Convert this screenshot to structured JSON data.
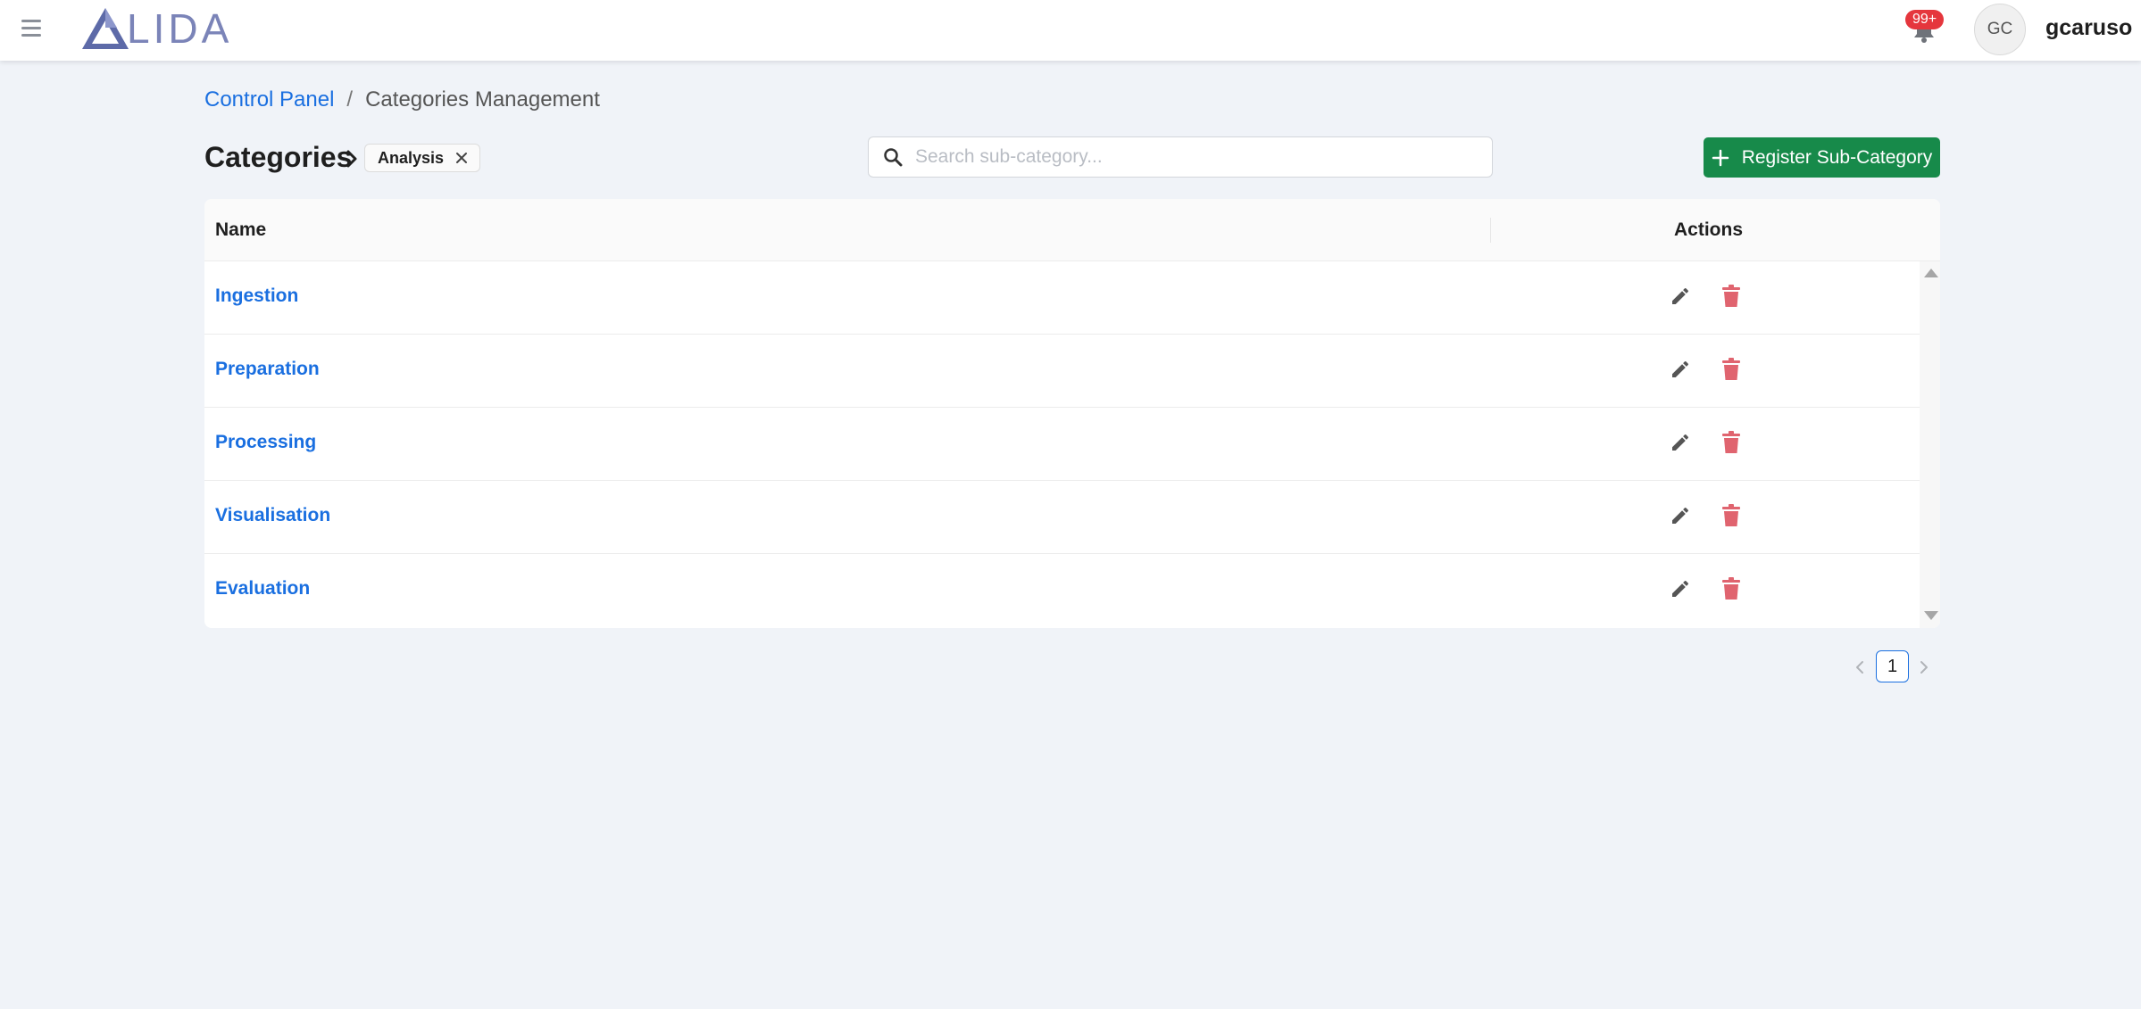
{
  "app": {
    "logo_text": "LIDA",
    "notifications_badge": "99+",
    "avatar_initials": "GC",
    "username": "gcaruso"
  },
  "breadcrumb": {
    "parent": "Control Panel",
    "separator": "/",
    "current": "Categories Management"
  },
  "header": {
    "title": "Categories",
    "filter_chip": "Analysis",
    "search_placeholder": "Search sub-category...",
    "register_label": "Register Sub-Category"
  },
  "table": {
    "columns": {
      "name": "Name",
      "actions": "Actions"
    },
    "rows": [
      {
        "name": "Ingestion"
      },
      {
        "name": "Preparation"
      },
      {
        "name": "Processing"
      },
      {
        "name": "Visualisation"
      },
      {
        "name": "Evaluation"
      }
    ]
  },
  "pagination": {
    "current_page": "1"
  },
  "icons": {
    "menu": "hamburger-menu-icon",
    "notifications": "bell-icon",
    "chip_close": "close-icon",
    "search": "search-icon",
    "register": "plus-icon",
    "edit": "pencil-icon",
    "delete": "trash-icon",
    "prev": "chevron-left-icon",
    "next": "chevron-right-icon"
  },
  "colors": {
    "background": "#f0f3f8",
    "link": "#1a6fe0",
    "primary_button": "#178a4a",
    "delete": "#e0646f",
    "edit": "#555555",
    "badge": "#e5363d",
    "logo": "#7b84b8"
  }
}
